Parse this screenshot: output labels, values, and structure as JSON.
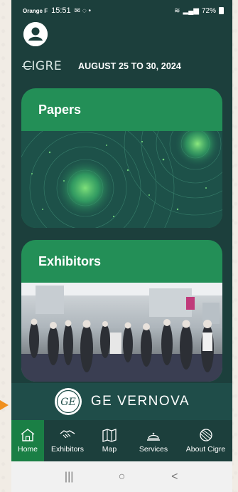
{
  "status_bar": {
    "carrier": "Orange F",
    "time": "15:51",
    "battery": "72%"
  },
  "header": {
    "logo_text": "CIGRE",
    "dates": "AUGUST 25 TO 30, 2024"
  },
  "cards": [
    {
      "title": "Papers"
    },
    {
      "title": "Exhibitors"
    }
  ],
  "sponsor": {
    "logo_text": "GE",
    "name": "GE VERNOVA"
  },
  "bottom_nav": {
    "items": [
      {
        "label": "Home",
        "icon": "home-icon",
        "active": true
      },
      {
        "label": "Exhibitors",
        "icon": "handshake-icon",
        "active": false
      },
      {
        "label": "Map",
        "icon": "map-icon",
        "active": false
      },
      {
        "label": "Services",
        "icon": "service-bell-icon",
        "active": false
      },
      {
        "label": "About Cigre",
        "icon": "globe-icon",
        "active": false
      }
    ]
  },
  "android_nav": {
    "recents": "|||",
    "home": "○",
    "back": "<"
  },
  "colors": {
    "background": "#1c3f3c",
    "accent": "#238f57",
    "active_nav": "#1a7f45"
  }
}
